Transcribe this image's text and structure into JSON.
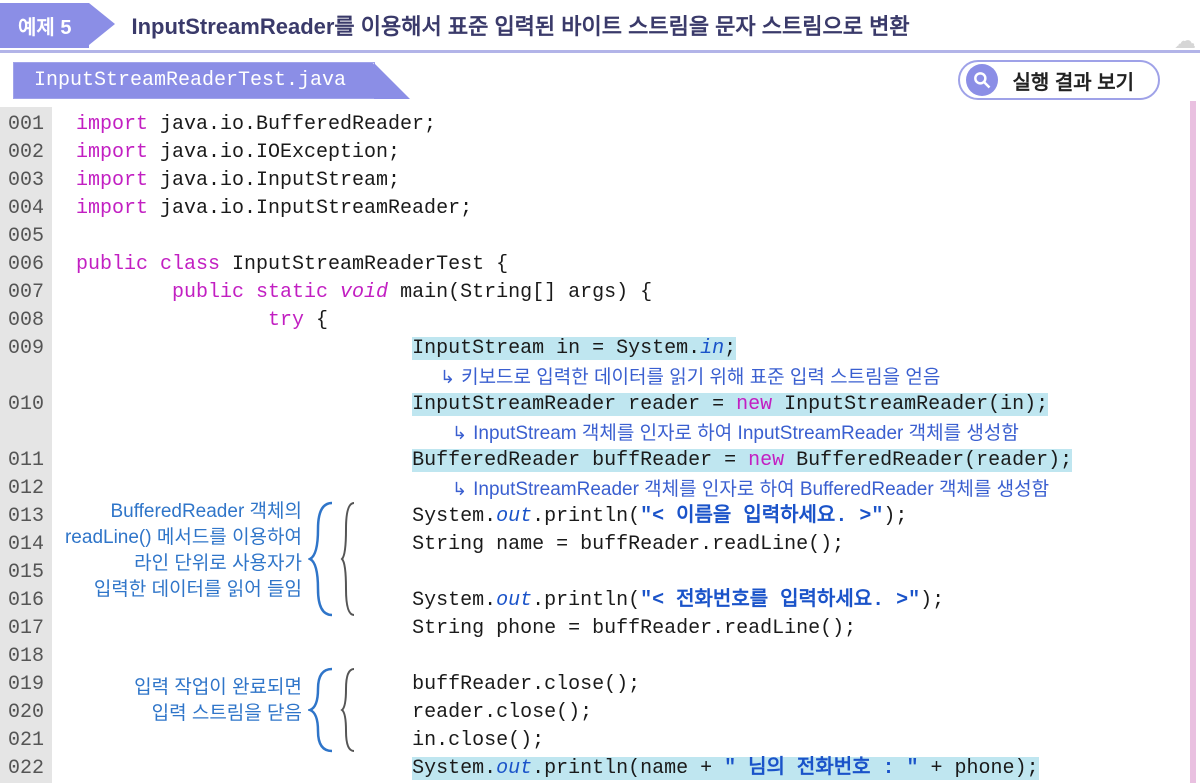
{
  "header": {
    "badge": "예제 5",
    "title": "InputStreamReader를 이용해서 표준 입력된 바이트 스트림을 문자 스트림으로 변환",
    "file_tab": "InputStreamReaderTest.java",
    "result_button": "실행 결과 보기"
  },
  "gutter_lines": [
    "001",
    "002",
    "003",
    "004",
    "005",
    "006",
    "007",
    "008",
    "009",
    "",
    "010",
    "",
    "011",
    "012",
    "013",
    "014",
    "015",
    "016",
    "017",
    "018",
    "019",
    "020",
    "021",
    "022"
  ],
  "code": {
    "l1_kw": "import",
    "l1_rest": " java.io.BufferedReader;",
    "l2_kw": "import",
    "l2_rest": " java.io.IOException;",
    "l3_kw": "import",
    "l3_rest": " java.io.InputStream;",
    "l4_kw": "import",
    "l4_rest": " java.io.InputStreamReader;",
    "l6_public": "public",
    "l6_class": " class",
    "l6_rest": " InputStreamReaderTest {",
    "l7_pub": "public",
    "l7_static": " static",
    "l7_void": " void",
    "l7_rest": " main(String[] args) {",
    "l8_try": "try",
    "l8_rest": " {",
    "l9_a": "InputStream in = System.",
    "l9_in": "in",
    "l9_b": ";",
    "l10_a": "InputStreamReader reader = ",
    "l10_new": "new",
    "l10_b": " InputStreamReader(in);",
    "l11_a": "BufferedReader buffReader = ",
    "l11_new": "new",
    "l11_b": " BufferedReader(reader);",
    "l13_a": "System.",
    "l13_out": "out",
    "l13_b": ".println(",
    "l13_str": "\"< 이름을 입력하세요. >\"",
    "l13_c": ");",
    "l14": "String name = buffReader.readLine();",
    "l16_a": "System.",
    "l16_out": "out",
    "l16_b": ".println(",
    "l16_str": "\"< 전화번호를 입력하세요. >\"",
    "l16_c": ");",
    "l17": "String phone = buffReader.readLine();",
    "l19": "buffReader.close();",
    "l20": "reader.close();",
    "l21": "in.close();",
    "l22_a": "System.",
    "l22_out": "out",
    "l22_b": ".println(name + ",
    "l22_str1": "\" 님의 전화번호 : \"",
    "l22_c": " + phone);"
  },
  "annotations": {
    "r1": "키보드로 입력한 데이터를 읽기 위해 표준 입력 스트림을 얻음",
    "r2": "InputStream 객체를 인자로 하여 InputStreamReader 객체를 생성함",
    "r3": "InputStreamReader 객체를 인자로 하여 BufferedReader 객체를 생성함",
    "left1_l1": "BufferedReader 객체의",
    "left1_l2": "readLine() 메서드를 이용하여",
    "left1_l3": "라인 단위로 사용자가",
    "left1_l4": "입력한 데이터를 읽어 들임",
    "left2_l1": "입력 작업이 완료되면",
    "left2_l2": "입력 스트림을 닫음"
  }
}
